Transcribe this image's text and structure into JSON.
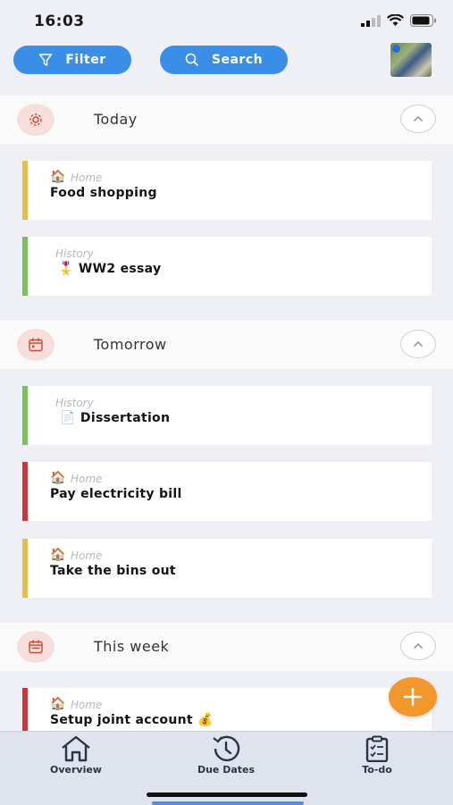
{
  "status": {
    "time": "16:03"
  },
  "header": {
    "filter_label": "Filter",
    "search_label": "Search"
  },
  "sections": [
    {
      "title": "Today",
      "icon": "gear-icon",
      "tasks": [
        {
          "category": "Home",
          "category_emoji": "🏠",
          "title": "Food shopping",
          "title_emoji": "",
          "color": "#e2c04a"
        },
        {
          "category": "History",
          "category_emoji": "",
          "title": "WW2 essay",
          "title_emoji": "🎖️",
          "color": "#7cc05a"
        }
      ]
    },
    {
      "title": "Tomorrow",
      "icon": "calendar-icon",
      "tasks": [
        {
          "category": "History",
          "category_emoji": "",
          "title": "Dissertation",
          "title_emoji": "📄",
          "color": "#7cc05a"
        },
        {
          "category": "Home",
          "category_emoji": "🏠",
          "title": "Pay electricity bill",
          "title_emoji": "",
          "color": "#c8383a"
        },
        {
          "category": "Home",
          "category_emoji": "🏠",
          "title": "Take the bins out",
          "title_emoji": "",
          "color": "#e2c04a"
        }
      ]
    },
    {
      "title": "This week",
      "icon": "calendar-week-icon",
      "tasks": [
        {
          "category": "Home",
          "category_emoji": "🏠",
          "title": "Setup joint account",
          "title_emoji": "💰",
          "color": "#c8383a"
        }
      ]
    }
  ],
  "tabs": [
    {
      "label": "Overview",
      "icon": "home-icon"
    },
    {
      "label": "Due Dates",
      "icon": "history-icon"
    },
    {
      "label": "To-do",
      "icon": "clipboard-icon"
    }
  ]
}
